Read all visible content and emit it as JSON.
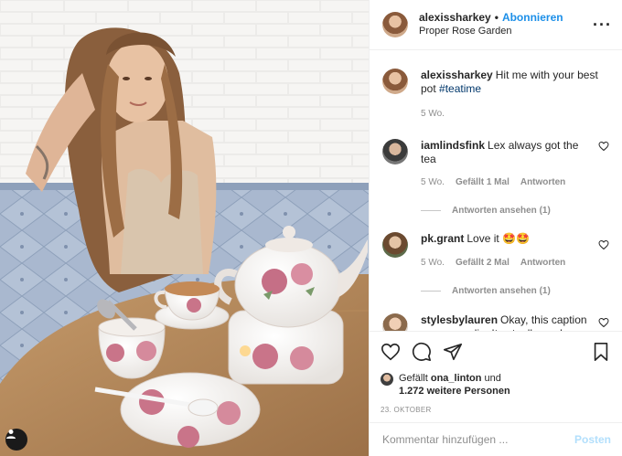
{
  "header": {
    "username": "alexissharkey",
    "separator": "•",
    "follow_label": "Abonnieren",
    "location": "Proper Rose Garden",
    "more_icon": "more-horizontal-icon"
  },
  "caption": {
    "username": "alexissharkey",
    "text": "Hit me with your best pot ",
    "hashtag": "#teatime",
    "age": "5 Wo."
  },
  "comments": [
    {
      "username": "iamlindsfink",
      "text": "Lex always got the tea",
      "age": "5 Wo.",
      "likes": "Gefällt 1 Mal",
      "reply": "Antworten",
      "view_replies": "Antworten ansehen (1)"
    },
    {
      "username": "pk.grant",
      "text": "Love it 🤩🤩",
      "age": "5 Wo.",
      "likes": "Gefällt 2 Mal",
      "reply": "Antworten",
      "view_replies": "Antworten ansehen (1)"
    },
    {
      "username": "stylesbylauren",
      "text": "Okay, this caption was a goodie. It actually made me"
    }
  ],
  "actions": {
    "like_icon": "heart-icon",
    "comment_icon": "comment-icon",
    "share_icon": "send-icon",
    "save_icon": "bookmark-icon"
  },
  "likes": {
    "prefix": "Gefällt",
    "user": "ona_linton",
    "and": "und",
    "others": "1.272 weitere Personen"
  },
  "date": "23. OKTOBER",
  "add_comment": {
    "placeholder": "Kommentar hinzufügen ...",
    "post_label": "Posten"
  },
  "colors": {
    "accent": "#1c8fe8",
    "post_disabled": "#b2dffc",
    "muted": "#8e8e8e",
    "hashtag": "#00376b"
  }
}
